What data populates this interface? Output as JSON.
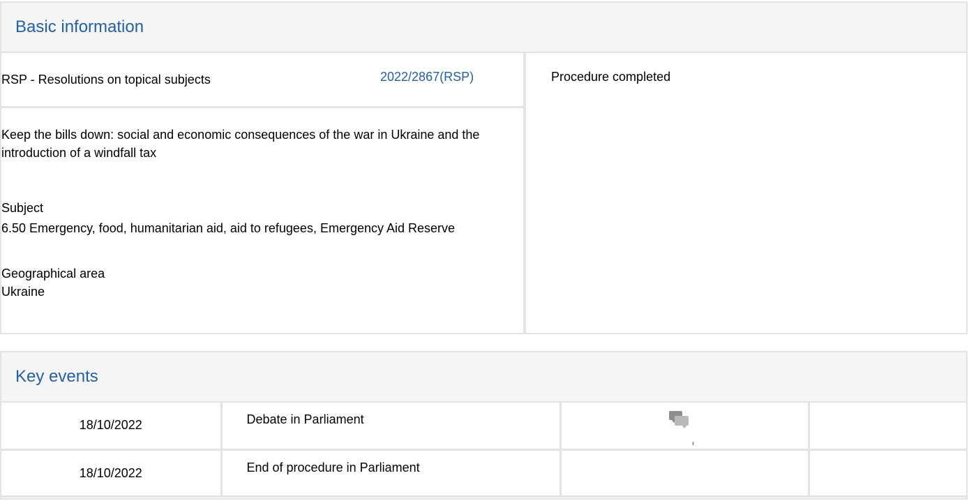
{
  "basic_information": {
    "header": "Basic information",
    "procedure_type": "RSP - Resolutions on topical subjects",
    "procedure_reference": "2022/2867(RSP)",
    "title": "Keep the bills down: social and economic consequences of the war in Ukraine and the introduction of a windfall tax",
    "subject_label": "Subject",
    "subject_value": "6.50 Emergency, food, humanitarian aid, aid to refugees, Emergency Aid Reserve",
    "geo_label": "Geographical area",
    "geo_value": "Ukraine",
    "status": "Procedure completed"
  },
  "key_events": {
    "header": "Key events",
    "rows": [
      {
        "date": "18/10/2022",
        "event": "Debate in Parliament",
        "icon": "debate-chat-icon"
      },
      {
        "date": "18/10/2022",
        "event": "End of procedure in Parliament",
        "icon": ""
      }
    ]
  },
  "colors": {
    "accent": "#2460a7",
    "border": "#e3e3e3",
    "header_bg": "#f5f5f5"
  }
}
